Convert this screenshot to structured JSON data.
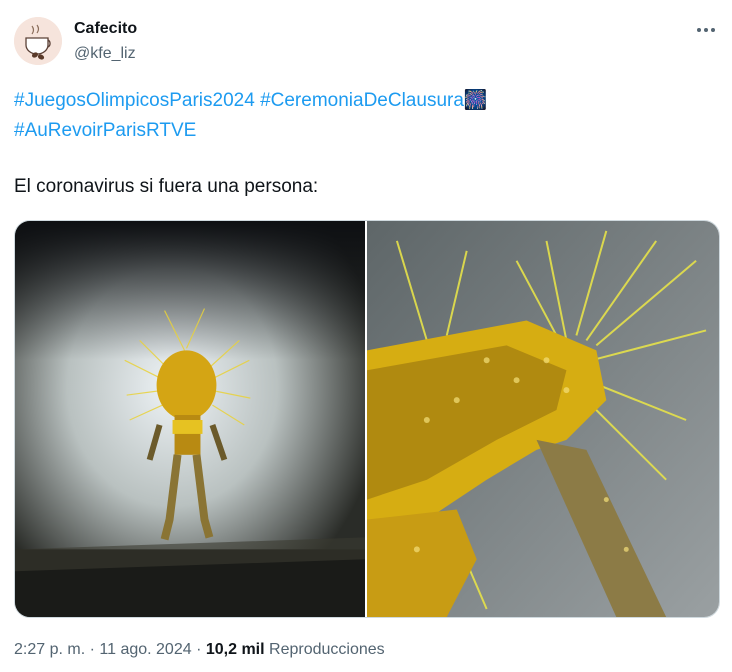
{
  "author": {
    "name": "Cafecito",
    "handle": "@kfe_liz"
  },
  "tweet": {
    "hashtags": [
      "#JuegosOlimpicosParis2024",
      "#CeremoniaDeClausura",
      "#AuRevoirParisRTVE"
    ],
    "emoji_after_hashtag": "🎆",
    "text": "El coronavirus si fuera una persona:"
  },
  "meta": {
    "time": "2:27 p. m.",
    "separator": "·",
    "date": "11 ago. 2024",
    "views_count": "10,2 mil",
    "views_label": "Reproducciones"
  },
  "colors": {
    "link": "#1d9bf0",
    "text": "#0f1419",
    "secondary": "#536471"
  }
}
